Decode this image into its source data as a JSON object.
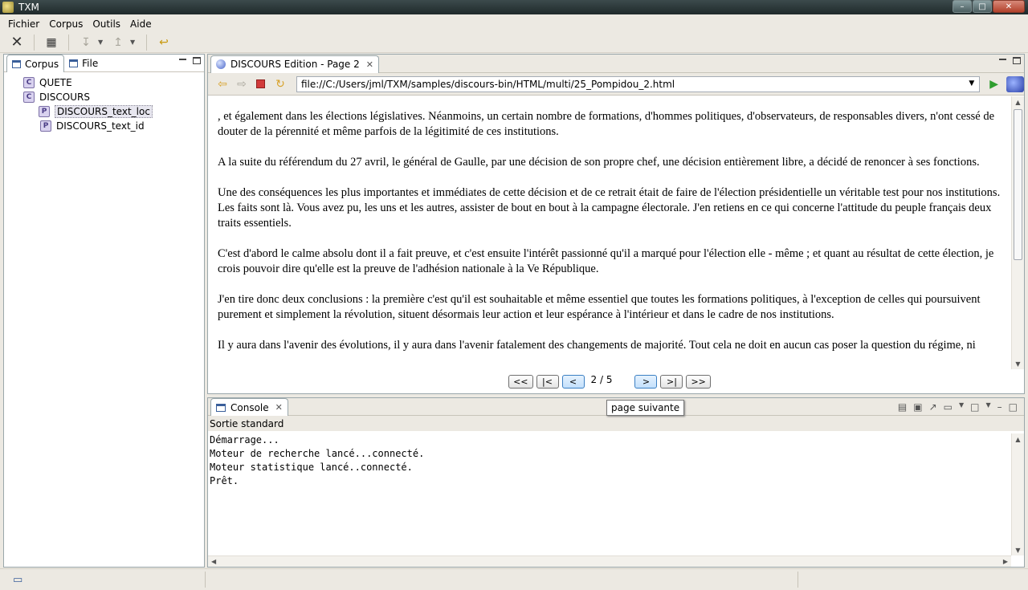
{
  "window": {
    "title": "TXM"
  },
  "menu": [
    "Fichier",
    "Corpus",
    "Outils",
    "Aide"
  ],
  "left_panel": {
    "tabs": [
      "Corpus",
      "File"
    ],
    "tree": [
      {
        "label": "QUETE",
        "icon": "C",
        "level": 1
      },
      {
        "label": "DISCOURS",
        "icon": "C",
        "level": 1
      },
      {
        "label": "DISCOURS_text_loc",
        "icon": "P",
        "level": 2,
        "selected": true
      },
      {
        "label": "DISCOURS_text_id",
        "icon": "P",
        "level": 2
      }
    ]
  },
  "editor": {
    "tab_title": "DISCOURS Edition - Page 2",
    "url": "file://C:/Users/jml/TXM/samples/discours-bin/HTML/multi/25_Pompidou_2.html",
    "paragraphs": [
      ", et également dans les élections législatives. Néanmoins, un certain nombre de formations, d'hommes politiques, d'observateurs, de responsables divers, n'ont cessé de douter de la pérennité et même parfois de la légitimité de ces institutions.",
      "A la suite du référendum du 27 avril, le général de Gaulle, par une décision de son propre chef, une décision entièrement libre, a décidé de renoncer à ses fonctions.",
      "Une des conséquences les plus importantes et immédiates de cette décision et de ce retrait était de faire de l'élection présidentielle un véritable test pour nos institutions. Les faits sont là. Vous avez pu, les uns et les autres, assister de bout en bout à la campagne électorale. J'en retiens en ce qui concerne l'attitude du peuple français deux traits essentiels.",
      "C'est d'abord le calme absolu dont il a fait preuve, et c'est ensuite l'intérêt passionné qu'il a marqué pour l'élection elle - même ; et quant au résultat de cette élection, je crois pouvoir dire qu'elle est la preuve de l'adhésion nationale à la Ve République.",
      "J'en tire donc deux conclusions : la première c'est qu'il est souhaitable et même essentiel que toutes les formations politiques, à l'exception de celles qui poursuivent purement et simplement la révolution, situent désormais leur action et leur espérance à l'intérieur et dans le cadre de nos institutions.",
      "Il y aura dans l'avenir des évolutions, il y aura dans l'avenir fatalement des changements de majorité. Tout cela ne doit en aucun cas poser la question du régime, ni"
    ],
    "pager": {
      "first": "<<",
      "start": "|<",
      "prev": "<",
      "current": "2 / 5",
      "next": ">",
      "end": ">|",
      "last": ">>"
    }
  },
  "console": {
    "tab_title": "Console",
    "label": "Sortie standard",
    "lines": [
      "Démarrage...",
      "Moteur de recherche lancé...connecté.",
      "Moteur statistique lancé..connecté.",
      "Prêt."
    ]
  },
  "tooltip": "page suivante"
}
